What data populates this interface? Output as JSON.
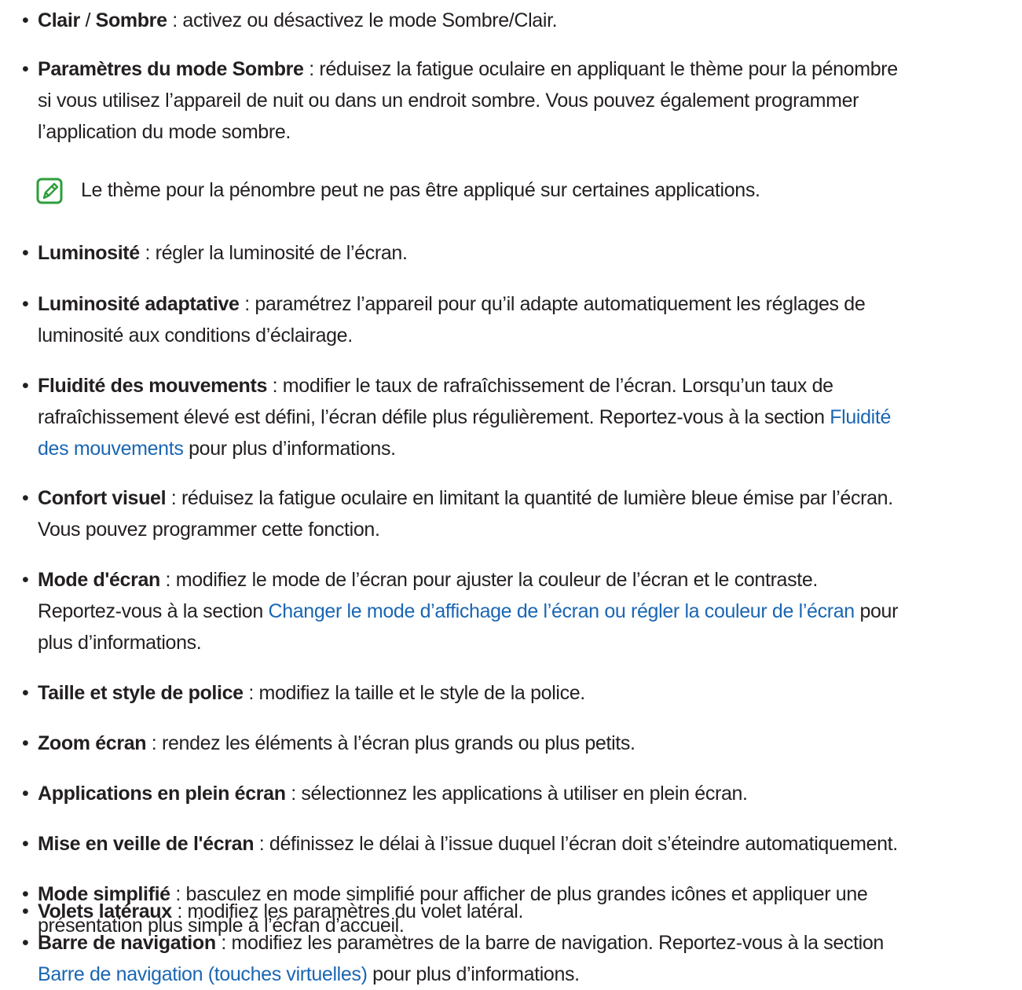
{
  "items": [
    {
      "term": "Clair",
      "sep": " / ",
      "term2": "Sombre",
      "desc": " : activez ou désactivez le mode Sombre/Clair."
    },
    {
      "term": "Paramètres du mode Sombre",
      "desc_lines": [
        " : réduisez la fatigue oculaire en appliquant le thème pour la pénombre",
        "si vous utilisez l’appareil de nuit ou dans un endroit sombre. Vous pouvez également programmer",
        "l’application du mode sombre."
      ]
    },
    {
      "term": "Luminosité",
      "desc": " : régler la luminosité de l’écran."
    },
    {
      "term": "Luminosité adaptative",
      "desc_lines": [
        " : paramétrez l’appareil pour qu’il adapte automatiquement les réglages de",
        "luminosité aux conditions d’éclairage."
      ]
    },
    {
      "term": "Fluidité des mouvements",
      "desc_lines": [
        " : modifier le taux de rafraîchissement de l’écran. Lorsqu’un taux de",
        "rafraîchissement élevé est défini, l’écran défile plus régulièrement. Reportez-vous à la section "
      ],
      "link_a": "Fluidité",
      "link_b": "des mouvements",
      "after_link": " pour plus d’informations."
    },
    {
      "term": "Confort visuel",
      "desc_lines": [
        " : réduisez la fatigue oculaire en limitant la quantité de lumière bleue émise par l’écran.",
        "Vous pouvez programmer cette fonction."
      ]
    },
    {
      "term": "Mode d'écran",
      "desc_lines": [
        " : modifiez le mode de l’écran pour ajuster la couleur de l’écran et le contraste.",
        "Reportez-vous à la section "
      ],
      "link": "Changer le mode d’affichage de l’écran ou régler la couleur de l’écran",
      "after_link_a": " pour",
      "after_link_b": "plus d’informations."
    },
    {
      "term": "Taille et style de police",
      "desc": " : modifiez la taille et le style de la police."
    },
    {
      "term": "Zoom écran",
      "desc": " : rendez les éléments à l’écran plus grands ou plus petits."
    },
    {
      "term": "Applications en plein écran",
      "desc": " : sélectionnez les applications à utiliser en plein écran."
    },
    {
      "term": "Mise en veille de l'écran",
      "desc": " : définissez le délai à l’issue duquel l’écran doit s’éteindre automatiquement."
    },
    {
      "term": "Mode simplifié",
      "desc_lines": [
        " : basculez en mode simplifié pour afficher de plus grandes icônes et appliquer une",
        "présentation plus simple à l’écran d’accueil."
      ]
    },
    {
      "term": "Volets latéraux",
      "desc": " : modifiez les paramètres du volet latéral."
    },
    {
      "term": "Barre de navigation",
      "desc_lines": [
        " : modifiez les paramètres de la barre de navigation. Reportez-vous à la section"
      ],
      "link": "Barre de navigation (touches virtuelles)",
      "after_link": " pour plus d’informations."
    }
  ],
  "note": {
    "icon": "note-pencil-icon",
    "text": "Le thème pour la pénombre peut ne pas être appliqué sur certaines applications."
  },
  "bullet_char": "•",
  "colors": {
    "text": "#231f20",
    "link": "#1a66b3",
    "icon": "#2e9e3a"
  }
}
